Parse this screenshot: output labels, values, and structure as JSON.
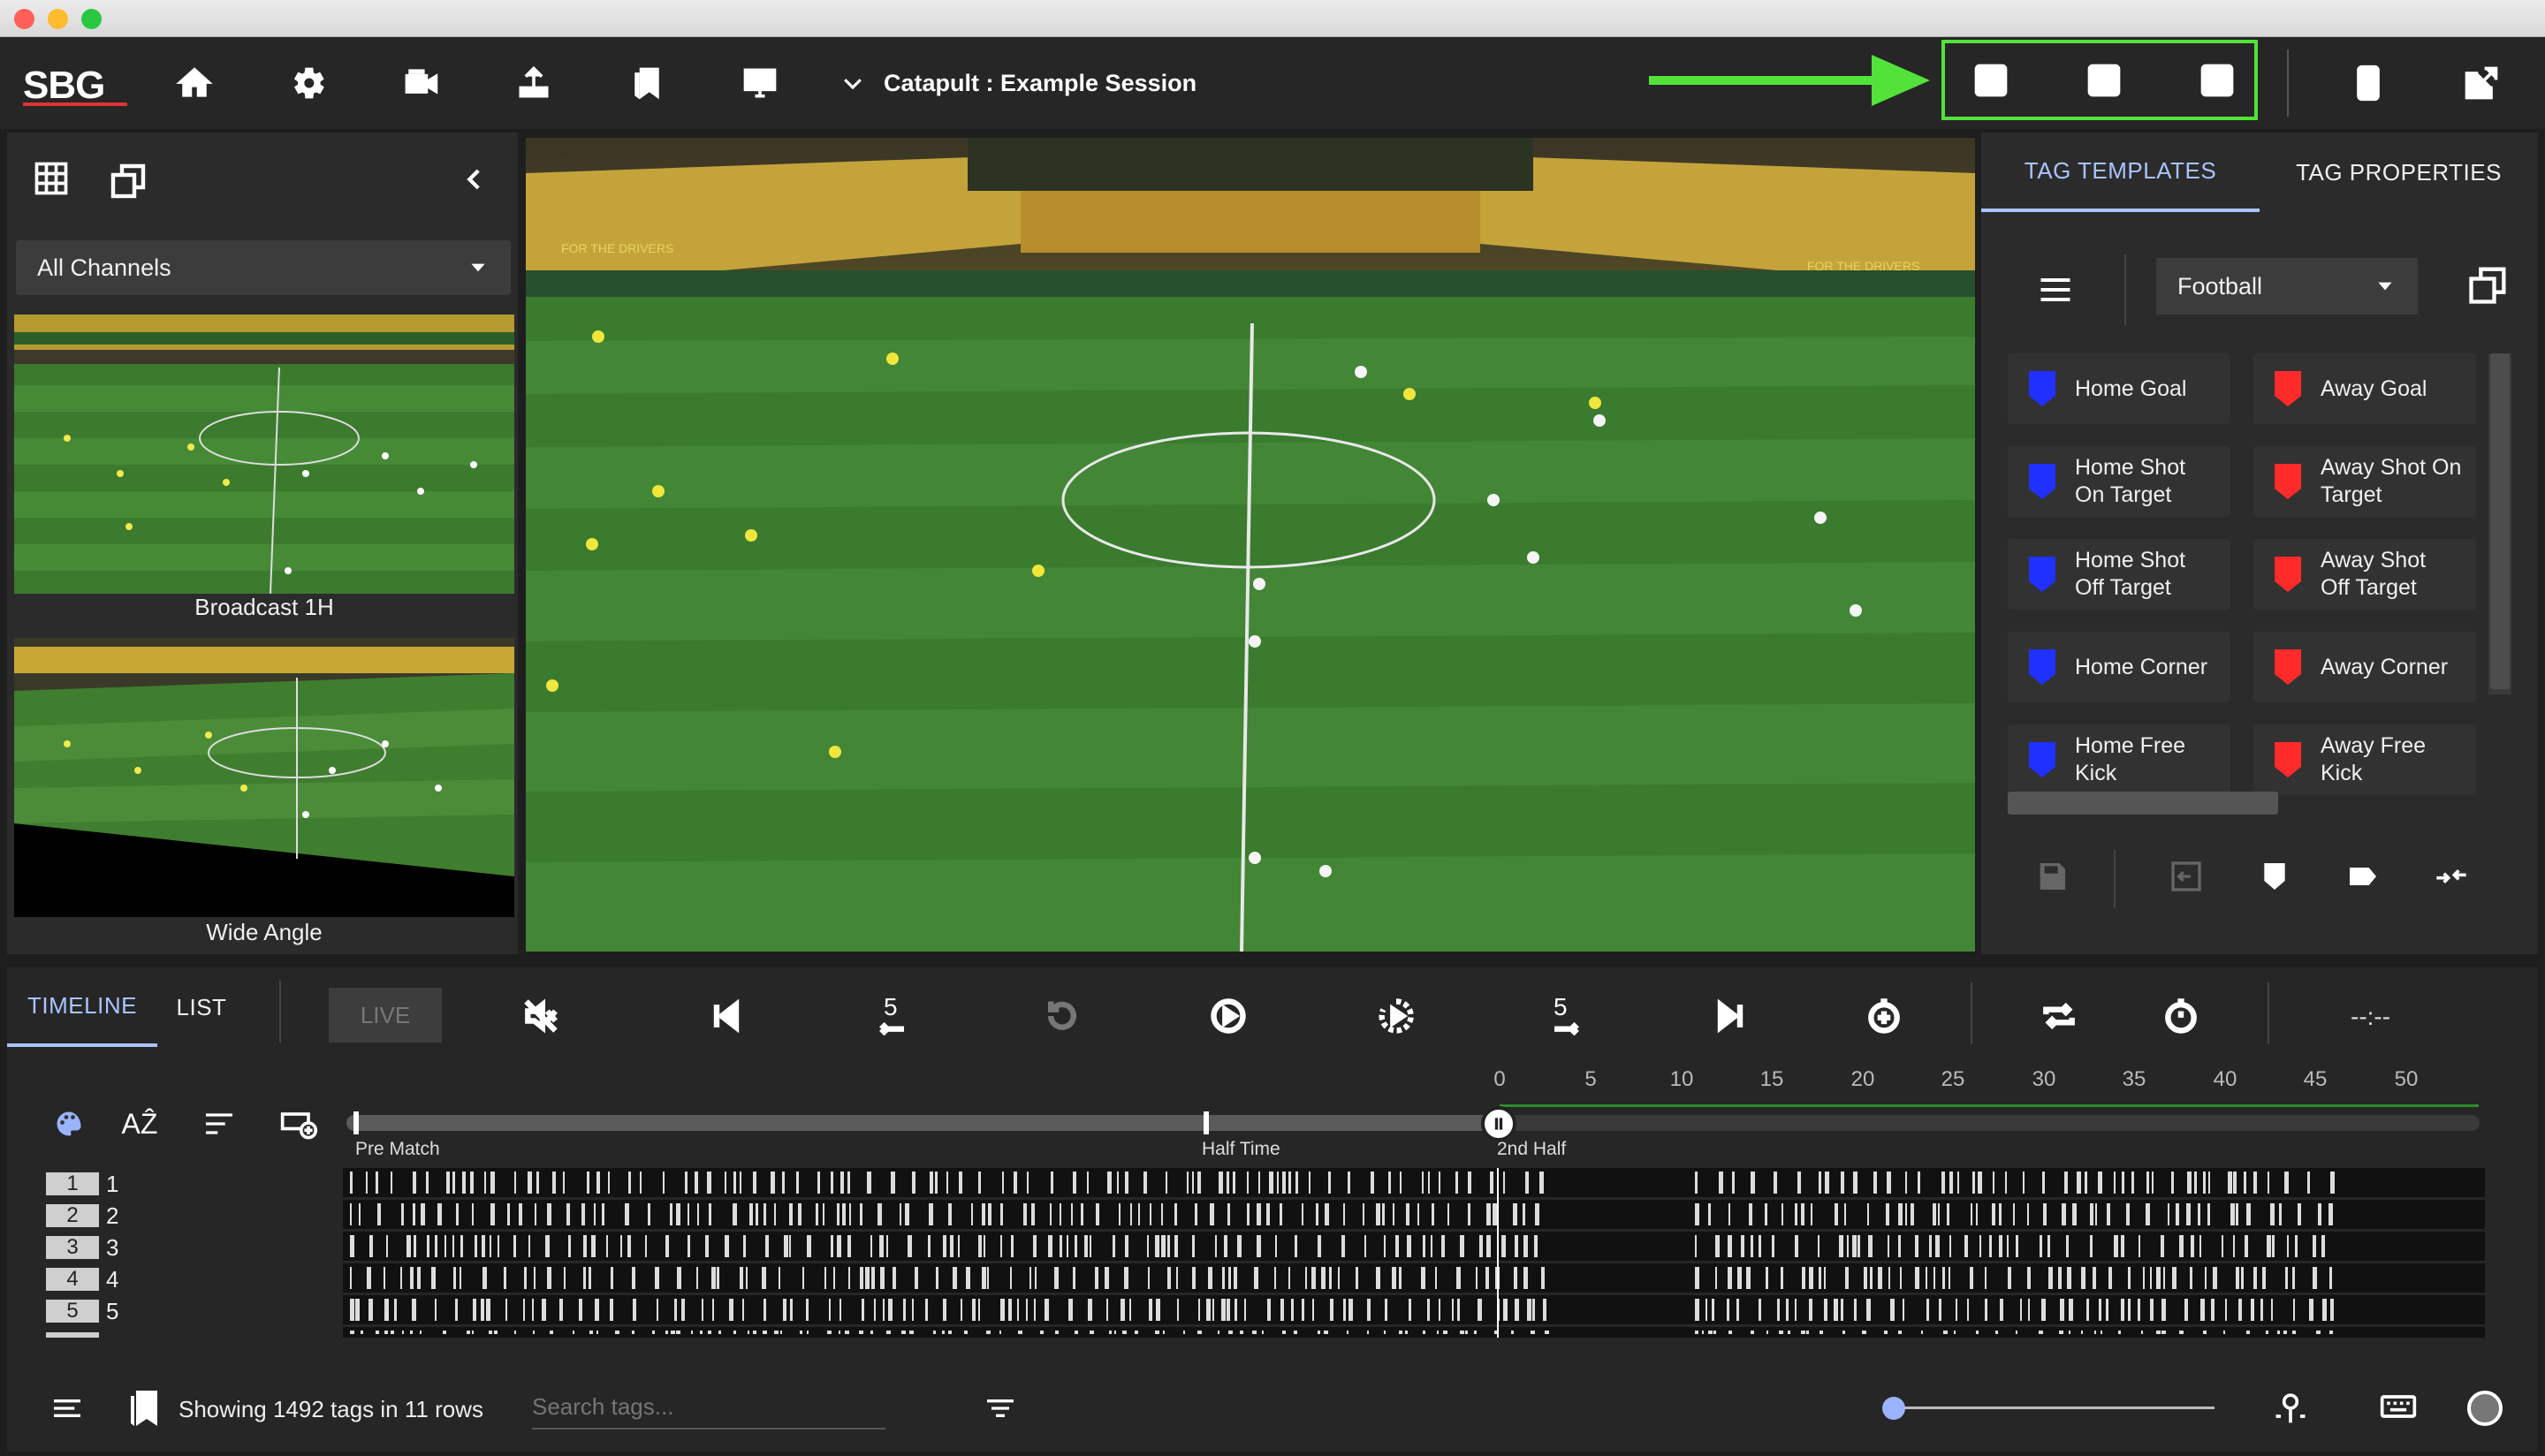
{
  "app": {
    "logo": "SBG",
    "session_title": "Catapult : Example Session",
    "colors": {
      "accent": "#53e23a",
      "home": "#2030ff",
      "away": "#ff2a2a",
      "tab_active": "#a9c4ff"
    }
  },
  "toolbar": {
    "icons": [
      "home-icon",
      "settings-icon",
      "camera-icon",
      "share-icon",
      "bookmarks-icon",
      "monitor-icon"
    ],
    "layout_icons": [
      "layout-single-icon",
      "layout-dual-icon",
      "layout-quad-icon"
    ],
    "right_icons": [
      "tablet-icon",
      "popout-icon"
    ]
  },
  "left_panel": {
    "channel_select": "All Channels",
    "thumbnails": [
      {
        "label": "Broadcast 1H"
      },
      {
        "label": "Wide Angle"
      }
    ]
  },
  "right_panel": {
    "tabs": [
      {
        "label": "TAG TEMPLATES",
        "active": true
      },
      {
        "label": "TAG PROPERTIES",
        "active": false
      }
    ],
    "template_select": "Football",
    "tags": [
      {
        "line1": "Home Goal",
        "line2": "",
        "team": "home"
      },
      {
        "line1": "Away Goal",
        "line2": "",
        "team": "away"
      },
      {
        "line1": "Home Shot",
        "line2": "On Target",
        "team": "home"
      },
      {
        "line1": "Away Shot On",
        "line2": "Target",
        "team": "away"
      },
      {
        "line1": "Home Shot",
        "line2": "Off Target",
        "team": "home"
      },
      {
        "line1": "Away Shot",
        "line2": "Off Target",
        "team": "away"
      },
      {
        "line1": "Home Corner",
        "line2": "",
        "team": "home"
      },
      {
        "line1": "Away Corner",
        "line2": "",
        "team": "away"
      },
      {
        "line1": "Home Free",
        "line2": "Kick",
        "team": "home"
      },
      {
        "line1": "Away Free",
        "line2": "Kick",
        "team": "away"
      }
    ]
  },
  "timeline": {
    "tabs": [
      {
        "label": "TIMELINE",
        "active": true
      },
      {
        "label": "LIST",
        "active": false
      }
    ],
    "live_label": "LIVE",
    "skip_back": "5",
    "skip_forward": "5",
    "time_display": "--:--",
    "scale": [
      "0",
      "5",
      "10",
      "15",
      "20",
      "25",
      "30",
      "35",
      "40",
      "45",
      "50"
    ],
    "markers": [
      {
        "label": "Pre Match"
      },
      {
        "label": "Half Time"
      },
      {
        "label": "2nd Half"
      }
    ],
    "rows": [
      {
        "badge": "1",
        "name": "1"
      },
      {
        "badge": "2",
        "name": "2"
      },
      {
        "badge": "3",
        "name": "3"
      },
      {
        "badge": "4",
        "name": "4"
      },
      {
        "badge": "5",
        "name": "5"
      }
    ]
  },
  "footer": {
    "status": "Showing 1492 tags in 11 rows",
    "search_placeholder": "Search tags...",
    "zoom_fraction": 0.0
  }
}
